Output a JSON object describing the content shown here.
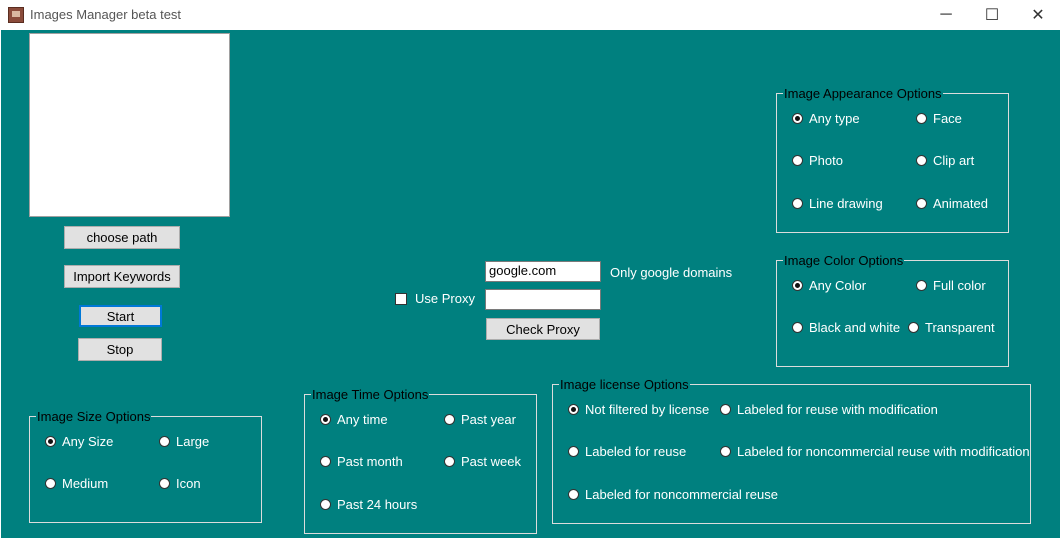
{
  "window": {
    "title": "Images Manager beta test",
    "minimize_glyph": "─",
    "maximize_glyph": "☐",
    "close_glyph": "✕",
    "background": "#00807f"
  },
  "buttons": {
    "choose_path": "choose path",
    "import_keywords": "Import Keywords",
    "start": "Start",
    "stop": "Stop",
    "check_proxy": "Check Proxy"
  },
  "domain": {
    "value": "google.com",
    "note": "Only google domains"
  },
  "proxy": {
    "label": "Use Proxy",
    "checked": false,
    "value": ""
  },
  "appearance": {
    "title": "Image Appearance Options",
    "options": [
      "Any type",
      "Face",
      "Photo",
      "Clip art",
      "Line drawing",
      "Animated"
    ],
    "selected": "Any type"
  },
  "color": {
    "title": "Image Color Options",
    "options": [
      "Any Color",
      "Full color",
      "Black and white",
      "Transparent"
    ],
    "selected": "Any Color"
  },
  "size": {
    "title": "Image Size Options",
    "options": [
      "Any Size",
      "Large",
      "Medium",
      "Icon"
    ],
    "selected": "Any Size"
  },
  "time": {
    "title": "Image Time Options",
    "options": [
      "Any time",
      "Past year",
      "Past month",
      "Past week",
      "Past 24 hours"
    ],
    "selected": "Any time"
  },
  "license": {
    "title": "Image license Options",
    "options": [
      "Not filtered by license",
      "Labeled for reuse with modification",
      "Labeled for reuse",
      "Labeled for noncommercial reuse with modification",
      "Labeled for noncommercial reuse"
    ],
    "selected": "Not filtered by license"
  }
}
